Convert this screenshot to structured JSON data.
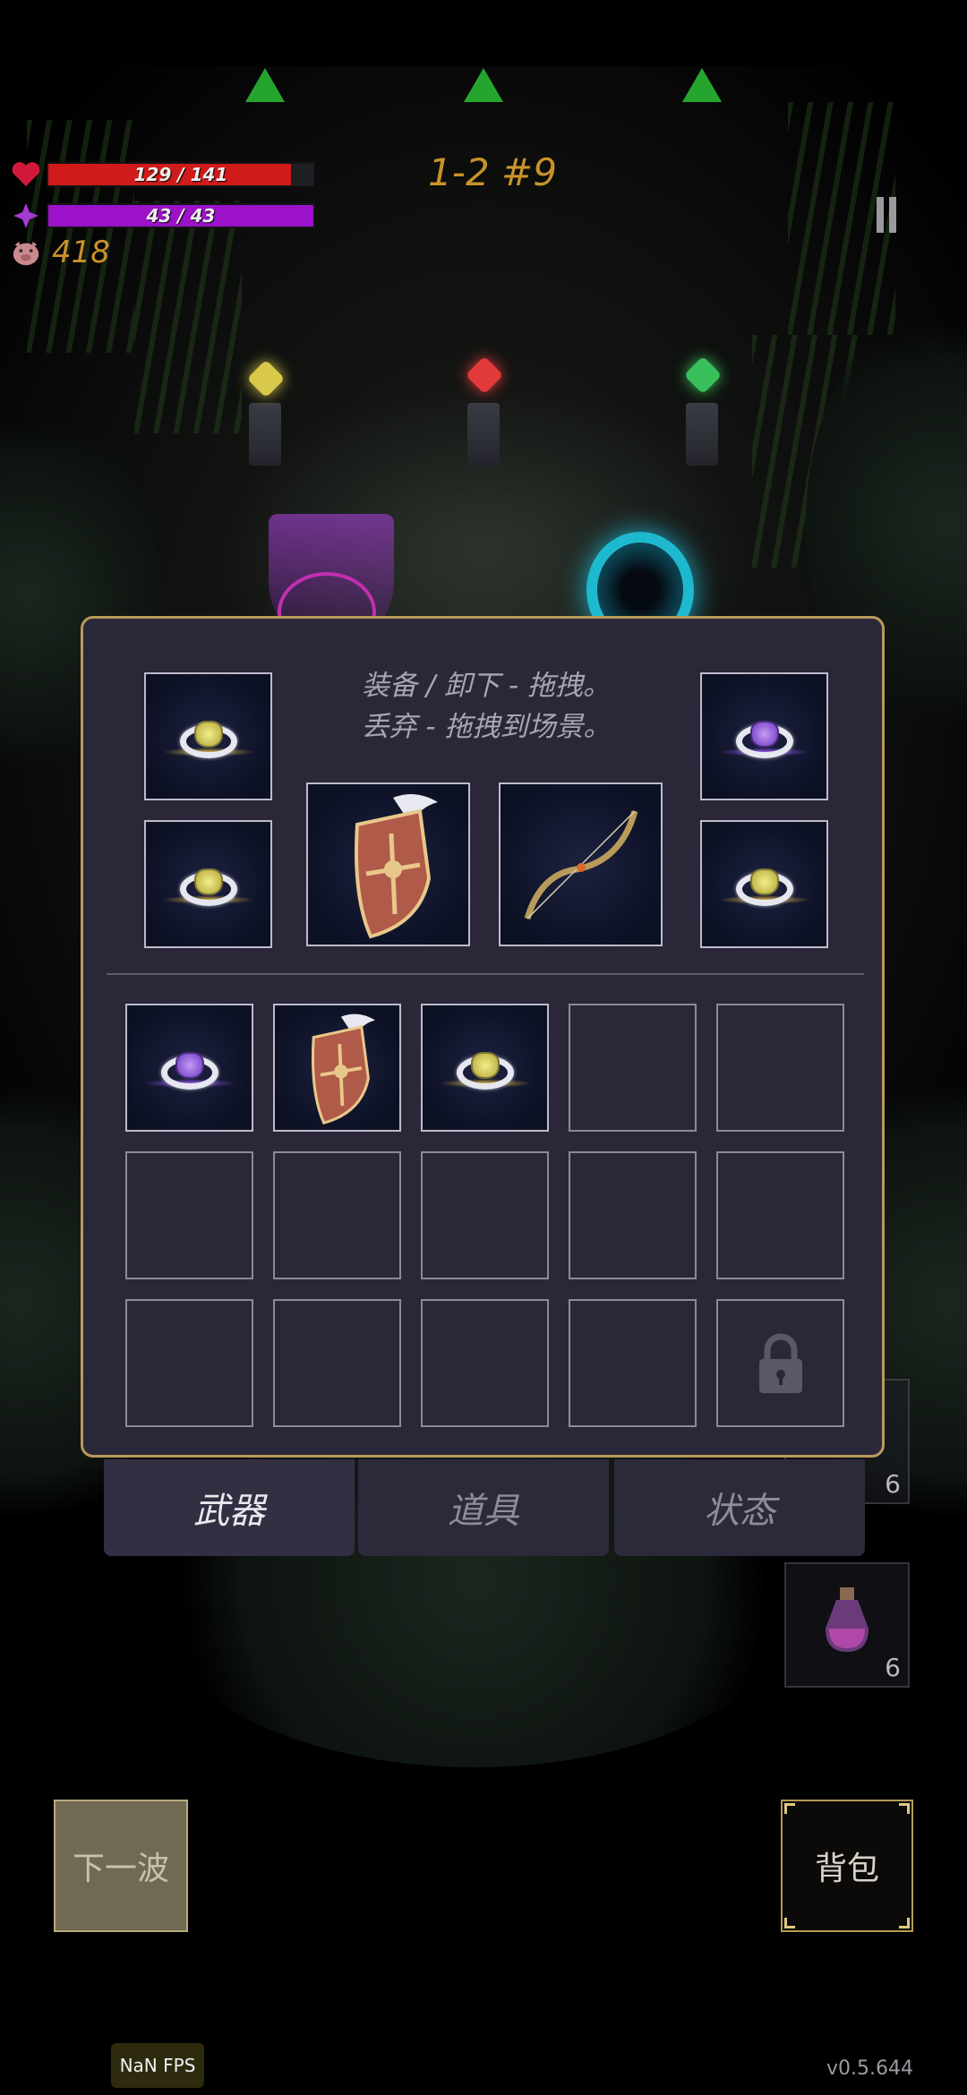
{
  "hud": {
    "health": {
      "text": "129 / 141",
      "value": 129,
      "max": 141,
      "color": "#d11a1a"
    },
    "mana": {
      "text": "43 / 43",
      "value": 43,
      "max": 43,
      "color": "#9b12c8"
    },
    "coins": "418",
    "level": "1-2 #9"
  },
  "inventory": {
    "hint_line1": "装备 / 卸下 - 拖拽。",
    "hint_line2": "丢弃 - 拖拽到场景。",
    "equipped": [
      {
        "slot": "ring-top-left",
        "icon": "gold-ring-icon"
      },
      {
        "slot": "ring-bottom-left",
        "icon": "gold-ring-icon"
      },
      {
        "slot": "offhand",
        "icon": "winged-shield-icon"
      },
      {
        "slot": "weapon",
        "icon": "bow-icon"
      },
      {
        "slot": "ring-top-right",
        "icon": "purple-ring-icon"
      },
      {
        "slot": "ring-bottom-right",
        "icon": "gold-ring-icon"
      }
    ],
    "bag": [
      "purple-ring-icon",
      "winged-shield-icon",
      "gold-ring-icon",
      "",
      "",
      "",
      "",
      "",
      "",
      "",
      "",
      "",
      "",
      "",
      "lock-icon"
    ]
  },
  "tabs": [
    {
      "label": "武器",
      "active": true
    },
    {
      "label": "道具",
      "active": false
    },
    {
      "label": "状态",
      "active": false
    }
  ],
  "buttons": {
    "next_wave": "下一波",
    "backpack": "背包"
  },
  "side_items": [
    {
      "count": "6"
    },
    {
      "count": "6"
    }
  ],
  "fps": "NaN FPS",
  "version": "v0.5.644"
}
